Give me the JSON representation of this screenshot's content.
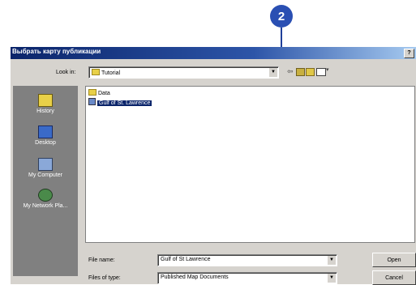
{
  "callout": {
    "number": "2"
  },
  "dialog": {
    "title": "Выбрать карту публикации",
    "help": "?",
    "look_in": {
      "label": "Look in:",
      "value": "Tutorial"
    },
    "places": [
      {
        "label": "History"
      },
      {
        "label": "Desktop"
      },
      {
        "label": "My Computer"
      },
      {
        "label": "My Network Pla..."
      }
    ],
    "files": [
      {
        "name": "Data",
        "type": "folder",
        "selected": false
      },
      {
        "name": "Gulf of St. Lawrence",
        "type": "map",
        "selected": true
      }
    ],
    "file_name": {
      "label": "File name:",
      "value": "Gulf of St Lawrence"
    },
    "files_of_type": {
      "label": "Files of type:",
      "value": "Published Map Documents"
    },
    "open_label": "Open",
    "cancel_label": "Cancel"
  }
}
